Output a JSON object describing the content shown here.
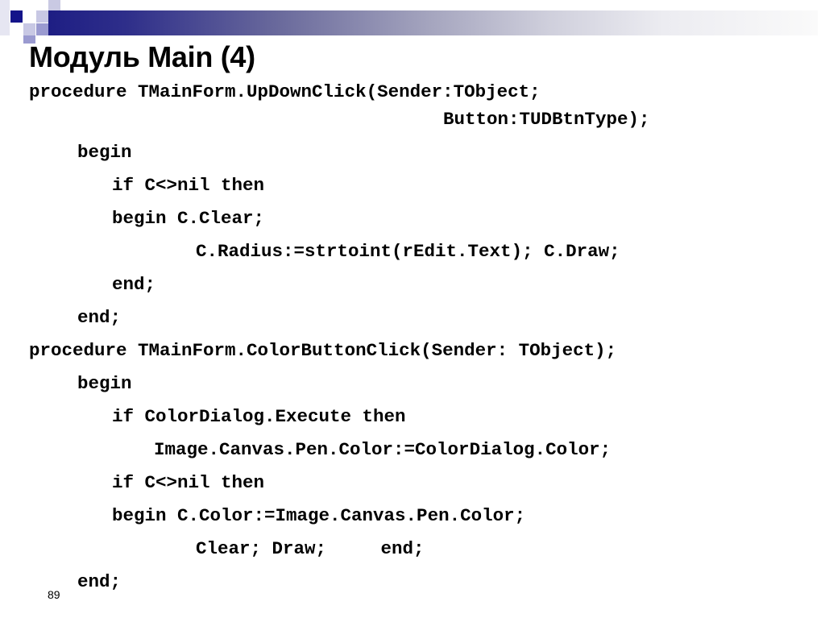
{
  "slide": {
    "title": "Модуль Main (4)",
    "page_number": "89",
    "accent_colors": {
      "bar_start": "#1e1e84",
      "bar_end": "#fafafa",
      "square_dark": "#14148a",
      "square_light": "#c8c8e4",
      "square_mid": "#9a9ad0"
    },
    "code_lines": [
      "procedure TMainForm.UpDownClick(Sender:TObject;",
      "Button:TUDBtnType);",
      "begin",
      "if C<>nil then",
      "begin C.Clear;",
      "C.Radius:=strtoint(rEdit.Text); C.Draw;",
      "end;",
      "end;",
      "procedure TMainForm.ColorButtonClick(Sender: TObject);",
      "begin",
      "if ColorDialog.Execute then",
      "Image.Canvas.Pen.Color:=ColorDialog.Color;",
      "if C<>nil then",
      "begin C.Color:=Image.Canvas.Pen.Color;",
      "Clear; Draw;     end;",
      "end;"
    ]
  }
}
